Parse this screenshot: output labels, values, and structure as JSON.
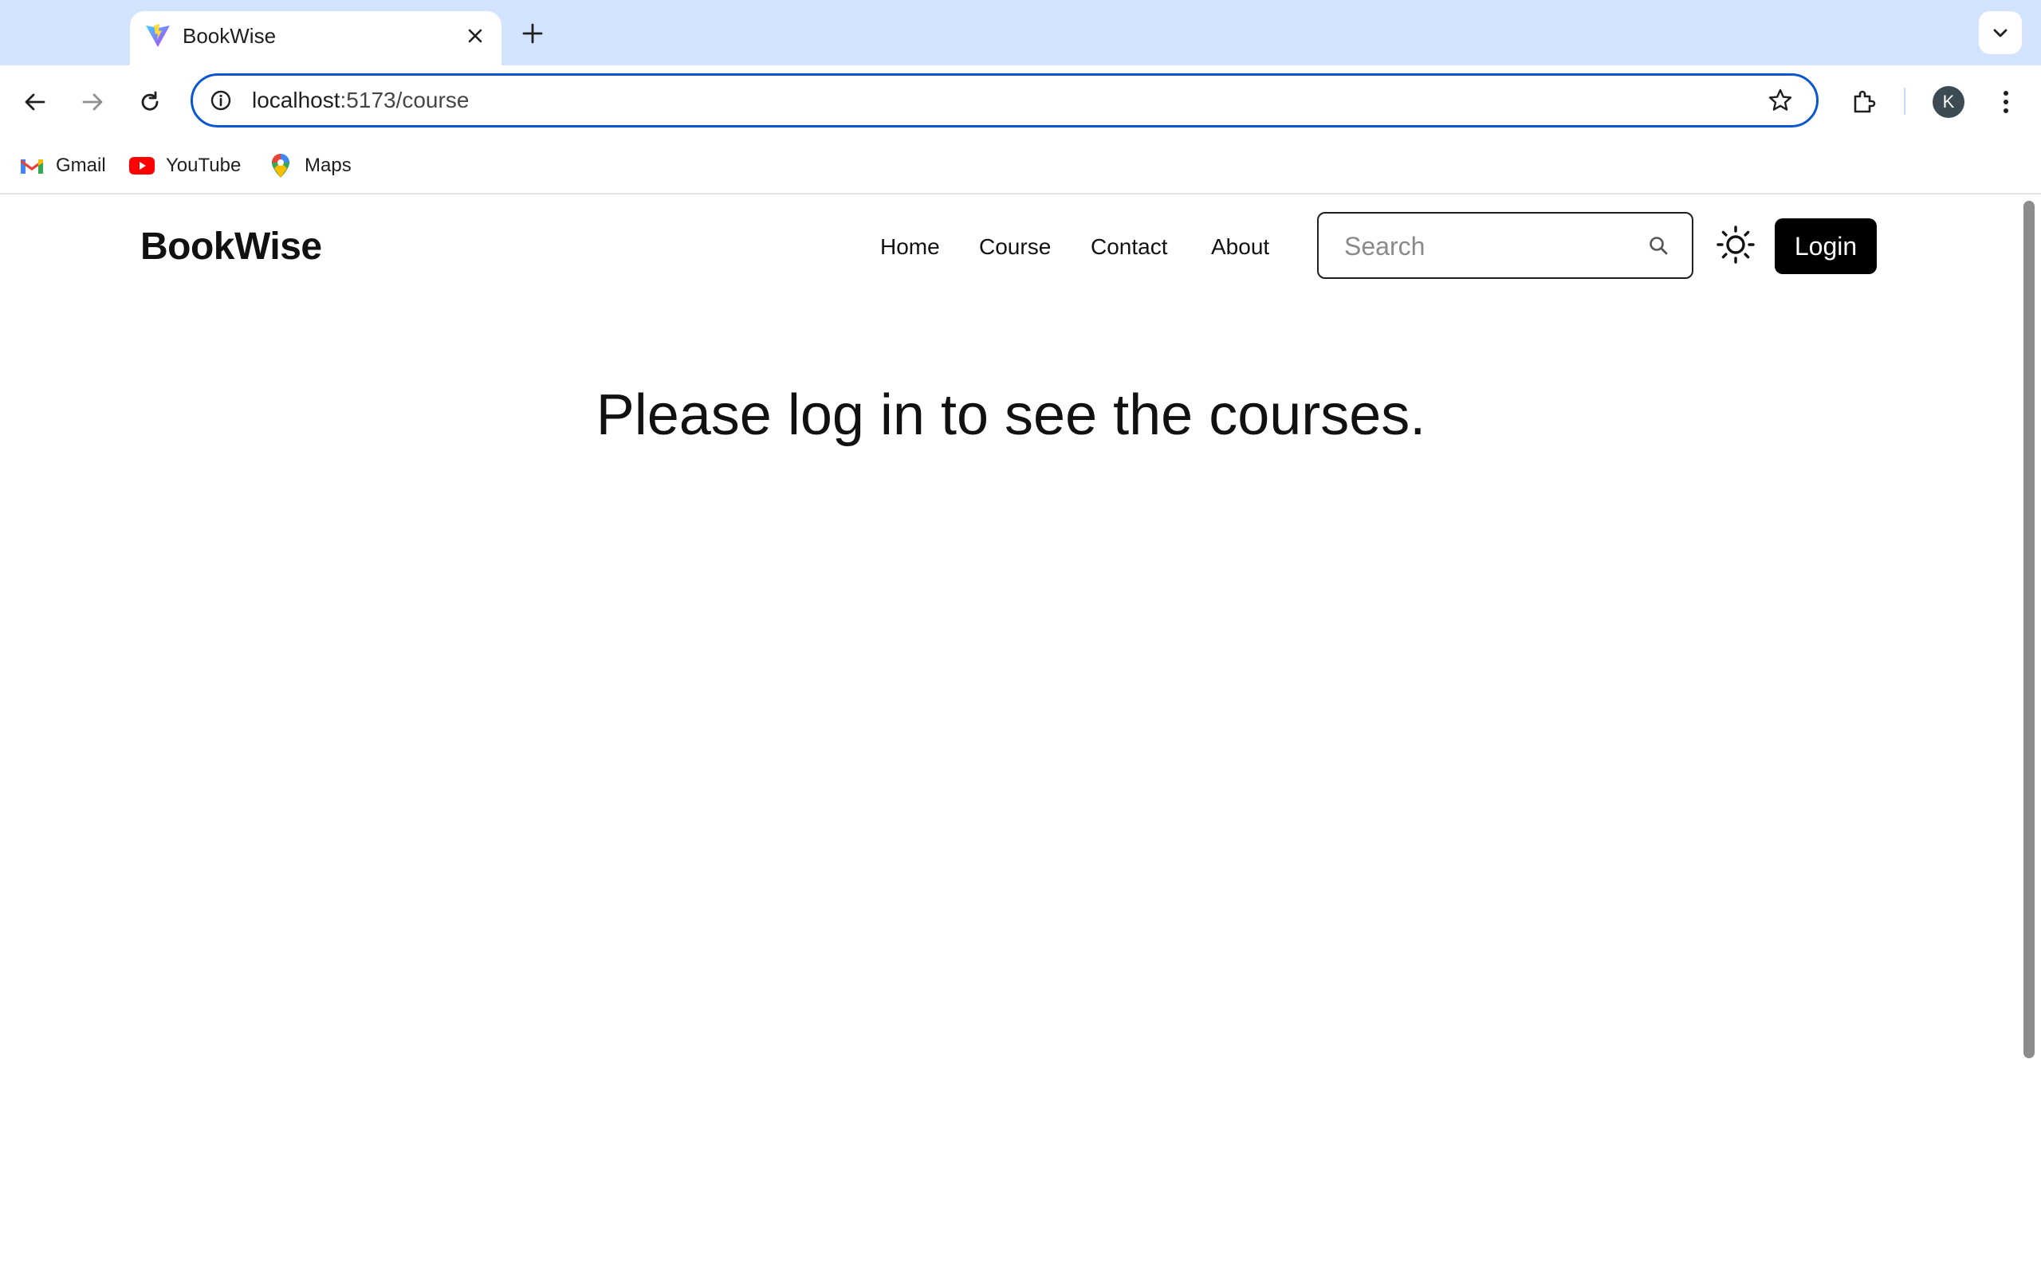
{
  "browser": {
    "tab_title": "BookWise",
    "url_host": "localhost",
    "url_path": ":5173/course",
    "avatar_initial": "K",
    "bookmarks": [
      {
        "label": "Gmail",
        "icon": "gmail-icon"
      },
      {
        "label": "YouTube",
        "icon": "youtube-icon"
      },
      {
        "label": "Maps",
        "icon": "maps-icon"
      }
    ],
    "accent_color": "#0b57d0",
    "tabstrip_color": "#d3e3fd"
  },
  "site": {
    "brand": "BookWise",
    "nav": [
      "Home",
      "Course",
      "Contact",
      "About"
    ],
    "search_placeholder": "Search",
    "login_label": "Login",
    "message": "Please log in to see the courses."
  }
}
